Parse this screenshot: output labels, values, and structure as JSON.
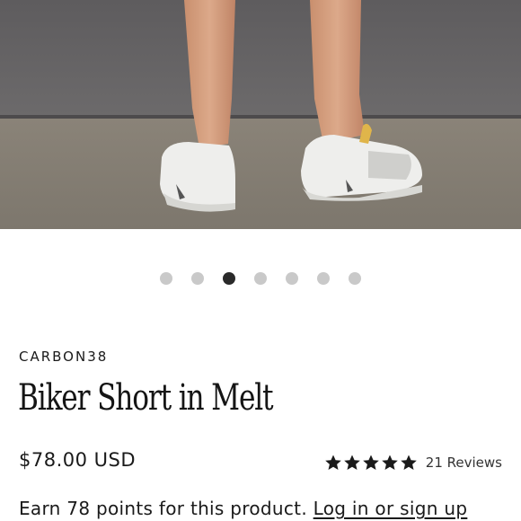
{
  "gallery": {
    "image_alt": "model wearing white sneakers, rear view",
    "dot_count": 7,
    "active_index": 2
  },
  "product": {
    "brand": "CARBON38",
    "title": "Biker Short in Melt",
    "price": "$78.00 USD",
    "rating": 5,
    "reviews_label": "21 Reviews"
  },
  "rewards": {
    "text": "Earn 78 points for this product.",
    "link_label": "Log in or sign up"
  },
  "colors": {
    "dot_inactive": "#c9c9c9",
    "dot_active": "#2a2a2a",
    "star": "#1a1a1a"
  }
}
